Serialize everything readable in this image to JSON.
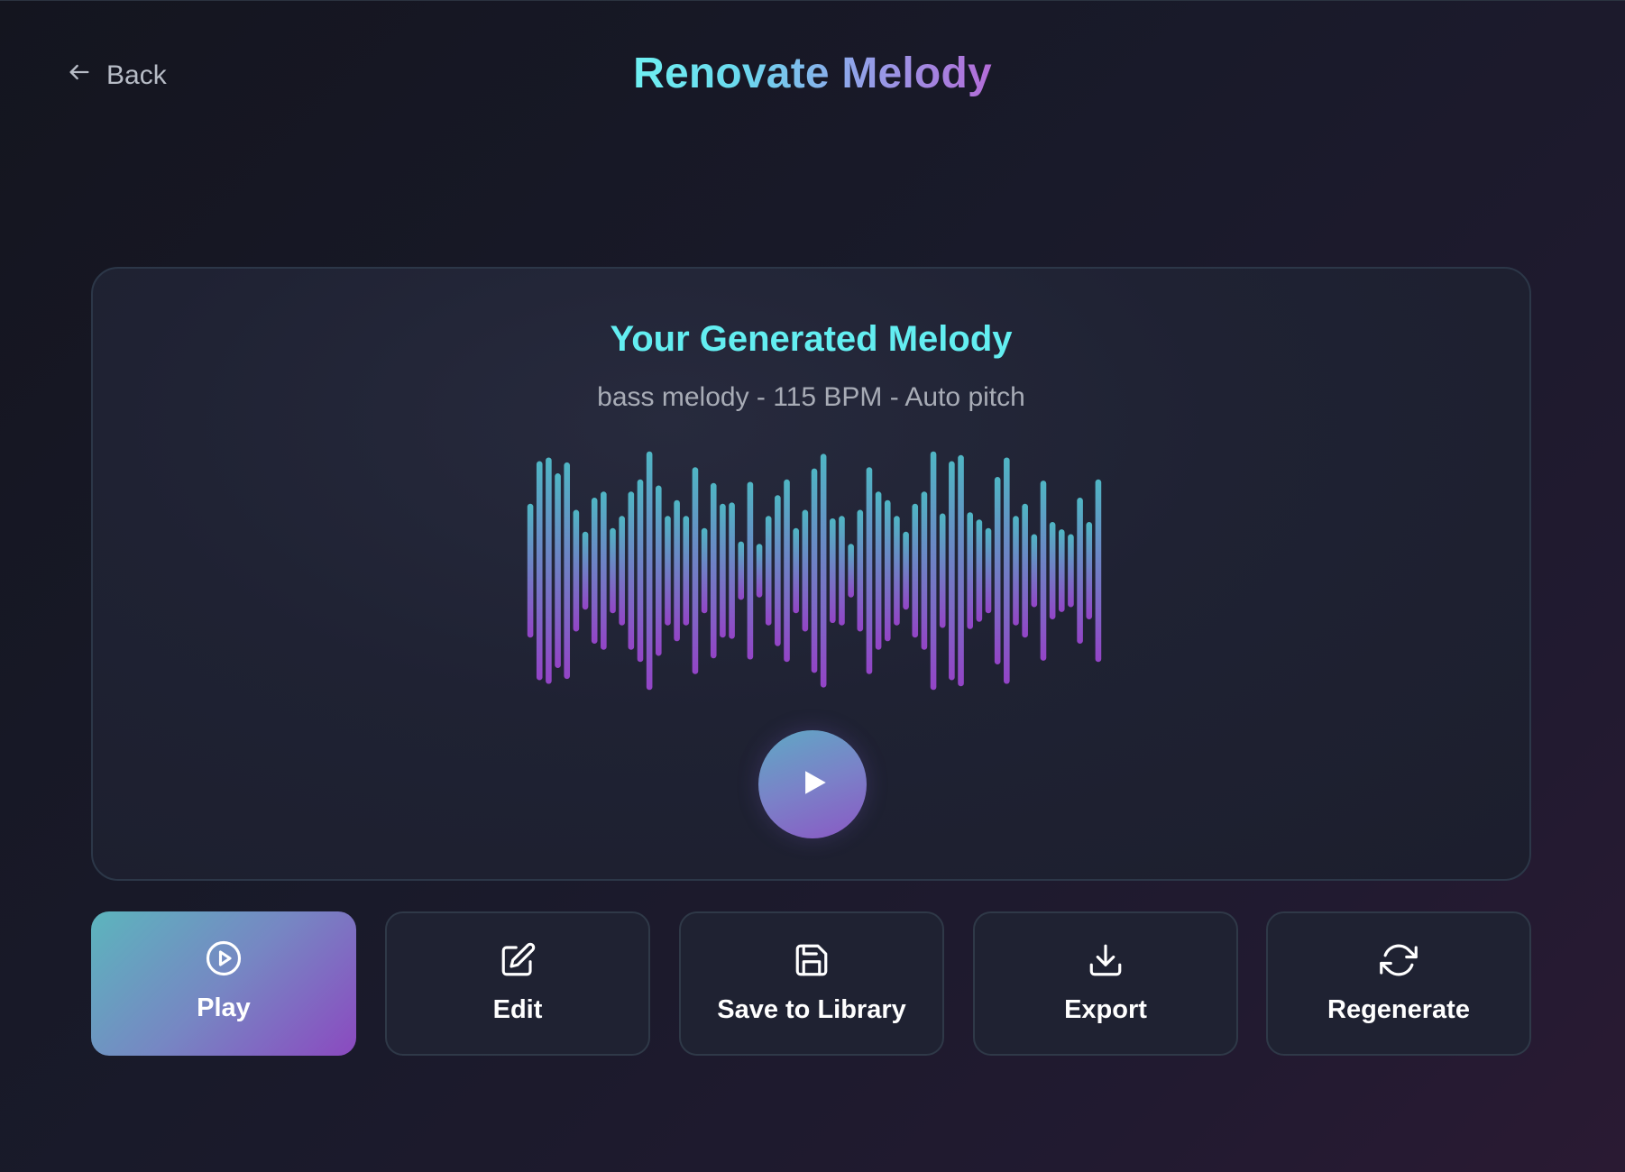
{
  "header": {
    "back_label": "Back",
    "title": "Renovate Melody"
  },
  "melody": {
    "title": "Your Generated Melody",
    "subtitle": "bass melody - 115 BPM - Auto pitch"
  },
  "waveform": {
    "bar_levels": [
      0.55,
      0.9,
      0.93,
      0.8,
      0.89,
      0.5,
      0.32,
      0.6,
      0.65,
      0.35,
      0.45,
      0.65,
      0.75,
      0.98,
      0.7,
      0.45,
      0.58,
      0.45,
      0.85,
      0.35,
      0.72,
      0.55,
      0.56,
      0.24,
      0.73,
      0.22,
      0.45,
      0.62,
      0.75,
      0.35,
      0.5,
      0.84,
      0.96,
      0.43,
      0.45,
      0.22,
      0.5,
      0.85,
      0.65,
      0.58,
      0.45,
      0.32,
      0.55,
      0.65,
      0.98,
      0.47,
      0.9,
      0.95,
      0.48,
      0.42,
      0.35,
      0.77,
      0.93,
      0.45,
      0.55,
      0.3,
      0.74,
      0.4,
      0.34,
      0.3,
      0.6,
      0.4,
      0.75
    ],
    "colors": {
      "top": "#4fb6c4",
      "bottom": "#9344c6"
    }
  },
  "actions": {
    "play": "Play",
    "edit": "Edit",
    "save": "Save to Library",
    "export": "Export",
    "regenerate": "Regenerate"
  },
  "icons": {
    "back": "arrow-left-icon",
    "play_circle": "play-icon",
    "play": "play-circle-icon",
    "edit": "edit-icon",
    "save": "save-icon",
    "export": "download-icon",
    "regenerate": "refresh-icon"
  },
  "colors": {
    "title_gradient_start": "#6ff0f2",
    "title_gradient_end": "#b36cd8",
    "card_title": "#63eef1",
    "primary_start": "#5cb5bd",
    "primary_end": "#8b49c0"
  }
}
